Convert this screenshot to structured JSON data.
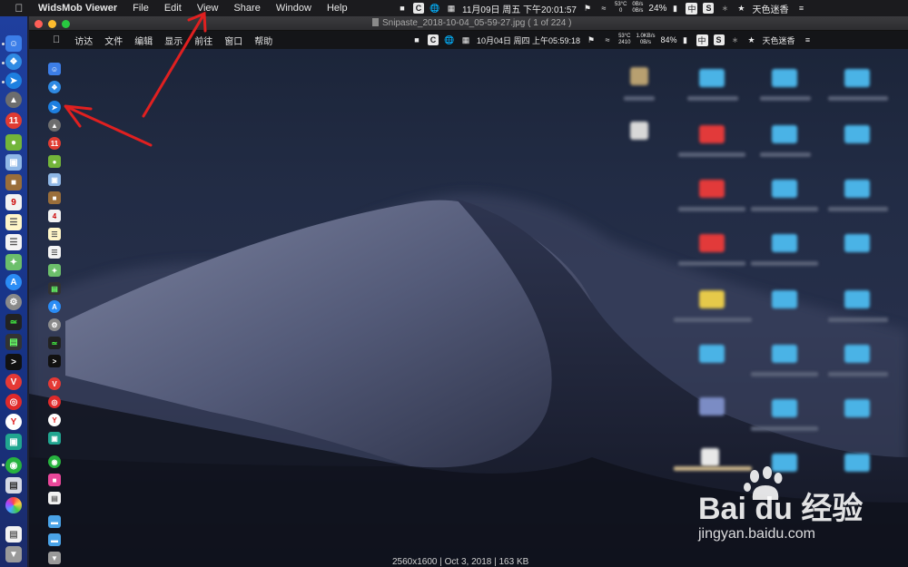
{
  "menubar": {
    "app_name": "WidsMob Viewer",
    "items": [
      "File",
      "Edit",
      "View",
      "Share",
      "Window",
      "Help"
    ],
    "datetime": "11月09日 周五 下午20:01:57",
    "cpu_temp": "53°C",
    "cpu_sub": "0",
    "net_up": "0B/s",
    "net_down": "0B/s",
    "battery": "24%",
    "input_method": "中",
    "user_name": "天色迷香"
  },
  "window": {
    "title": "Snipaste_2018-10-04_05-59-27.jpg ( 1 of 224 )"
  },
  "screenshot": {
    "menubar": {
      "items": [
        "访达",
        "文件",
        "编辑",
        "显示",
        "前往",
        "窗口",
        "帮助"
      ],
      "datetime": "10月04日 周四 上午05:59:18",
      "cpu_temp": "53°C",
      "cpu_sub": "2410",
      "net_up": "1.0KB/s",
      "net_down": "0B/s",
      "battery": "84%",
      "input_method": "中",
      "user_name": "天色迷香"
    }
  },
  "info_bar": "2560x1600 | Oct 3, 2018 | 163 KB",
  "watermark": {
    "logo_text": "Bai du 经验",
    "url": "jingyan.baidu.com"
  },
  "colors": {
    "annotation_arrow": "#e02020",
    "dock_background": "#1f3f9e",
    "close_light": "#ff5f57",
    "minimize_light": "#febc2e",
    "zoom_light": "#28c840"
  }
}
